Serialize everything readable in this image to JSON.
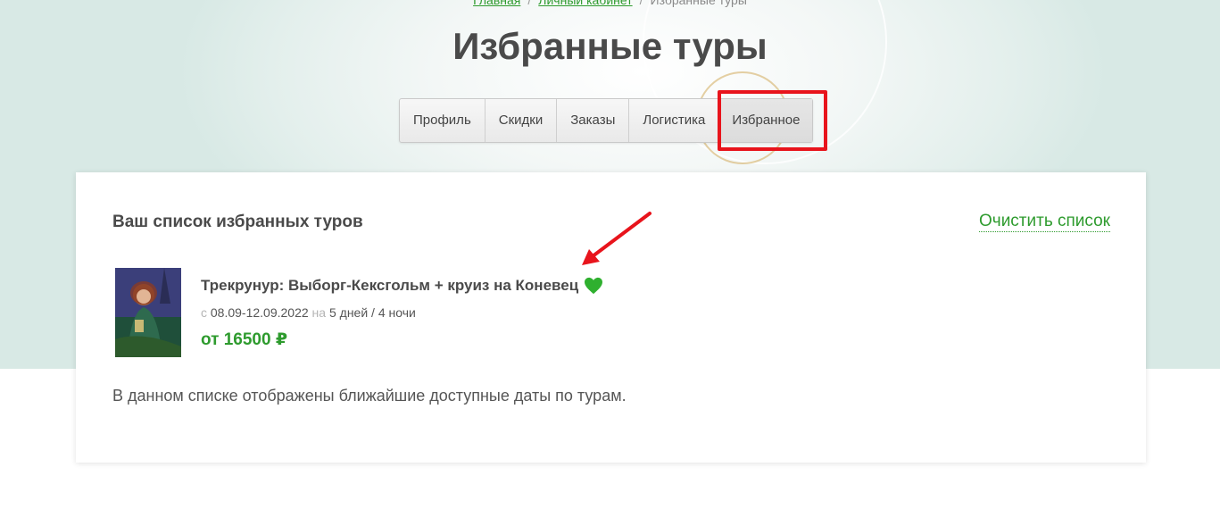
{
  "breadcrumb": {
    "home": "Главная",
    "cabinet": "Личный кабинет",
    "current": "Избранные туры"
  },
  "page_title": "Избранные туры",
  "tabs": [
    {
      "label": "Профиль"
    },
    {
      "label": "Скидки"
    },
    {
      "label": "Заказы"
    },
    {
      "label": "Логистика"
    },
    {
      "label": "Избранное",
      "active": true
    }
  ],
  "favorites": {
    "heading": "Ваш список избранных туров",
    "clear_label": "Очистить список",
    "tour": {
      "title": "Трекрунур: Выборг-Кексгольм + круиз на Коневец",
      "date_prefix": "с",
      "dates": "08.09-12.09.2022",
      "duration_prefix": "на",
      "duration": "5 дней / 4 ночи",
      "price": "от 16500 ₽",
      "heart_icon": "heart-icon"
    },
    "note": "В данном списке отображены ближайшие доступные даты по турам."
  },
  "colors": {
    "accent_green": "#2e9b2e",
    "highlight_red": "#e8141c",
    "heart_green": "#2fb02f"
  }
}
